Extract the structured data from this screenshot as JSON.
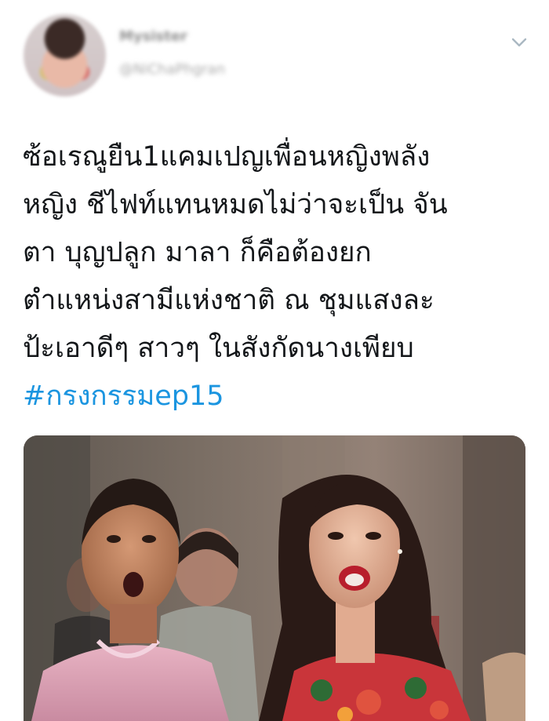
{
  "user": {
    "name": "Mysister",
    "handle": "@NiChaPhgran"
  },
  "icons": {
    "menu": "chevron-down-icon"
  },
  "tweet": {
    "lines": [
      "ซ้อเรณูยืน1แคมเปญเพื่อนหญิงพลัง",
      "หญิง ชีไฟท์แทนหมดไม่ว่าจะเป็น จัน",
      "ตา บุญปลูก มาลา ก็คือต้องยก",
      "ตำแหน่งสามีแห่งชาติ ณ ชุมแสงละ",
      "ป้ะเอาดีๆ สาวๆ ในสังกัดนางเพียบ"
    ],
    "hashtag": "#กรงกรรมep15"
  },
  "colors": {
    "text": "#14171a",
    "hashtag": "#1b95e0",
    "chevron": "#aab8c2"
  }
}
